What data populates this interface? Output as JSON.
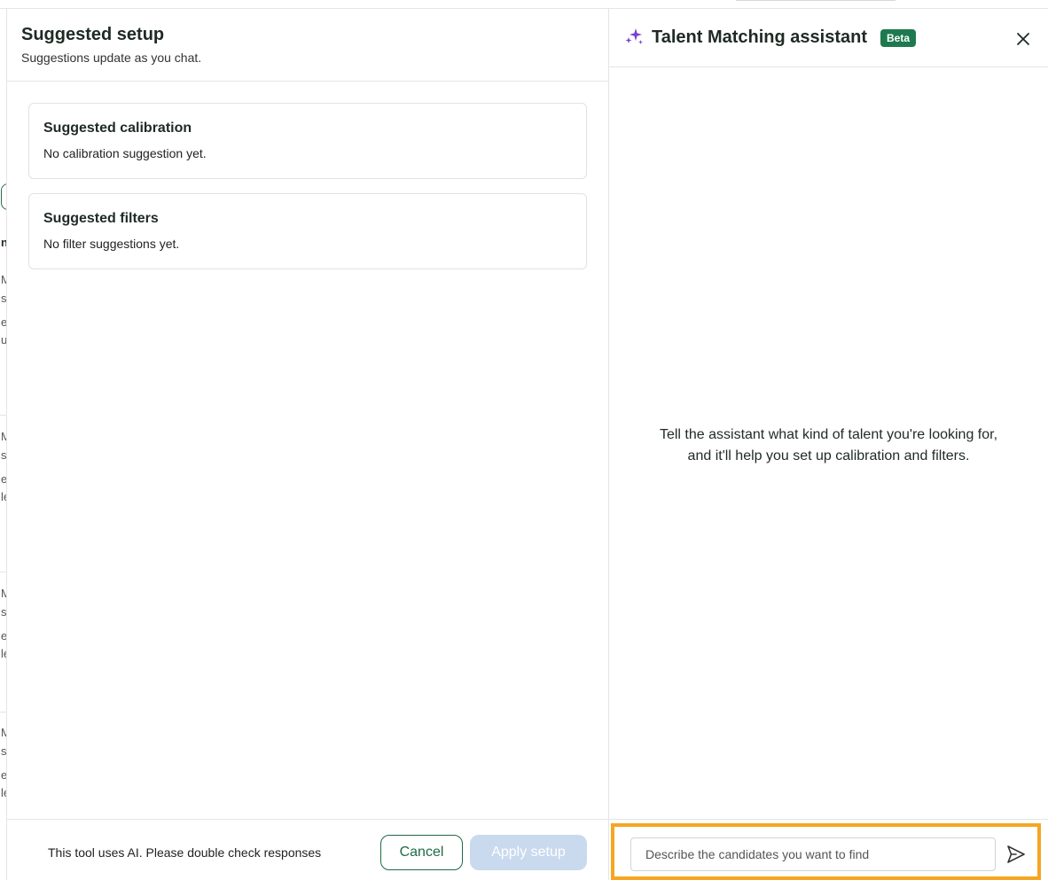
{
  "setup": {
    "title": "Suggested setup",
    "subtitle": "Suggestions update as you chat.",
    "cards": [
      {
        "title": "Suggested calibration",
        "text": "No calibration suggestion yet."
      },
      {
        "title": "Suggested filters",
        "text": "No filter suggestions yet."
      }
    ],
    "footer": {
      "ai_note": "This tool uses AI. Please double check responses",
      "cancel_label": "Cancel",
      "apply_label": "Apply setup"
    }
  },
  "assistant": {
    "title": "Talent Matching assistant",
    "badge": "Beta",
    "empty_line1": "Tell the assistant what kind of talent you're looking for,",
    "empty_line2": "and it'll help you set up calibration and filters.",
    "input_placeholder": "Describe the candidates you want to find",
    "icons": {
      "header": "sparkle-icon",
      "close": "close-icon",
      "send": "send-icon"
    }
  },
  "colors": {
    "brand_green": "#1e7a4e",
    "apply_disabled": "#c9d9ee",
    "focus_outline": "#f5a623",
    "sparkle_purple": "#7b3fd1"
  }
}
